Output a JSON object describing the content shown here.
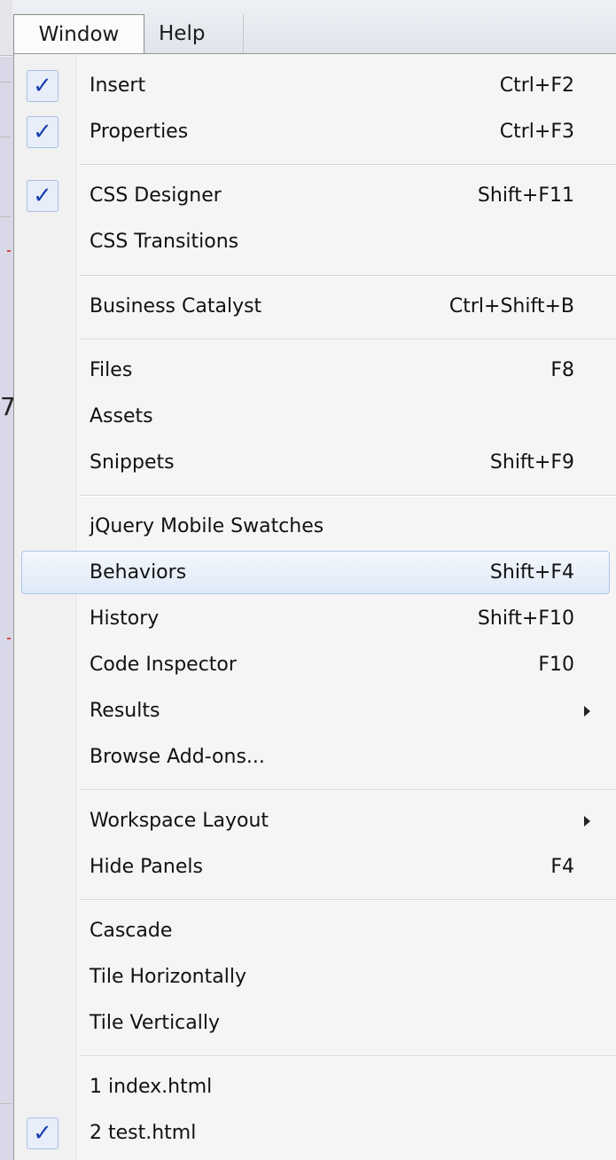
{
  "menubar": {
    "window_label": "Window",
    "help_label": "Help"
  },
  "menu": {
    "items": [
      {
        "label": "Insert",
        "shortcut": "Ctrl+F2",
        "checked": true
      },
      {
        "label": "Properties",
        "shortcut": "Ctrl+F3",
        "checked": true
      },
      {
        "label": "CSS Designer",
        "shortcut": "Shift+F11",
        "checked": true
      },
      {
        "label": "CSS Transitions",
        "shortcut": ""
      },
      {
        "label": "Business Catalyst",
        "shortcut": "Ctrl+Shift+B"
      },
      {
        "label": "Files",
        "shortcut": "F8"
      },
      {
        "label": "Assets",
        "shortcut": ""
      },
      {
        "label": "Snippets",
        "shortcut": "Shift+F9"
      },
      {
        "label": "jQuery Mobile Swatches",
        "shortcut": ""
      },
      {
        "label": "Behaviors",
        "shortcut": "Shift+F4",
        "highlighted": true
      },
      {
        "label": "History",
        "shortcut": "Shift+F10"
      },
      {
        "label": "Code Inspector",
        "shortcut": "F10"
      },
      {
        "label": "Results",
        "shortcut": "",
        "submenu": true
      },
      {
        "label": "Browse Add-ons...",
        "shortcut": ""
      },
      {
        "label": "Workspace Layout",
        "shortcut": "",
        "submenu": true
      },
      {
        "label": "Hide Panels",
        "shortcut": "F4"
      },
      {
        "label": "Cascade",
        "shortcut": ""
      },
      {
        "label": "Tile Horizontally",
        "shortcut": ""
      },
      {
        "label": "Tile Vertically",
        "shortcut": ""
      },
      {
        "label": "1 index.html",
        "shortcut": ""
      },
      {
        "label": "2 test.html",
        "shortcut": "",
        "checked": true
      }
    ],
    "check_glyph": "✓",
    "check_icon": "checkmark-icon",
    "submenu_icon": "submenu-arrow-icon"
  },
  "colors": {
    "check": "#1a3fb0",
    "highlight_border": "#a9c6ec",
    "menu_bg": "#f5f5f5"
  }
}
